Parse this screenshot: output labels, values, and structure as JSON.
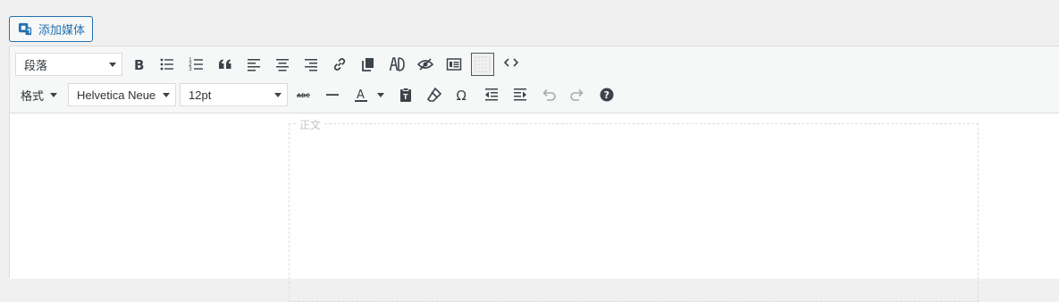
{
  "media_button": {
    "label": "添加媒体",
    "icon": "add-media-icon"
  },
  "toolbar": {
    "block_format": {
      "value": "段落"
    },
    "formats_menu": {
      "label": "格式"
    },
    "font_family": {
      "value": "Helvetica Neue"
    },
    "font_size": {
      "value": "12pt"
    },
    "row1_icons": [
      "bold-icon",
      "bullet-list-icon",
      "numbered-list-icon",
      "blockquote-icon",
      "align-left-icon",
      "align-center-icon",
      "align-right-icon",
      "link-icon",
      "copy-icon",
      "ad-icon",
      "hide-icon",
      "caption-icon",
      "table-icon",
      "code-icon"
    ],
    "row2_icons": [
      "strikethrough-icon",
      "horizontal-line-icon",
      "text-color-icon",
      "paste-text-icon",
      "clear-formatting-icon",
      "special-character-icon",
      "outdent-icon",
      "indent-icon",
      "undo-icon",
      "redo-icon",
      "help-icon"
    ],
    "strikethrough_glyph": "ABC",
    "text_color_letter": "A",
    "omega_glyph": "Ω"
  },
  "content": {
    "body_label": "正文"
  },
  "colors": {
    "accent": "#2271b1",
    "icon": "#3c434a",
    "disabled": "#a7aaad"
  }
}
